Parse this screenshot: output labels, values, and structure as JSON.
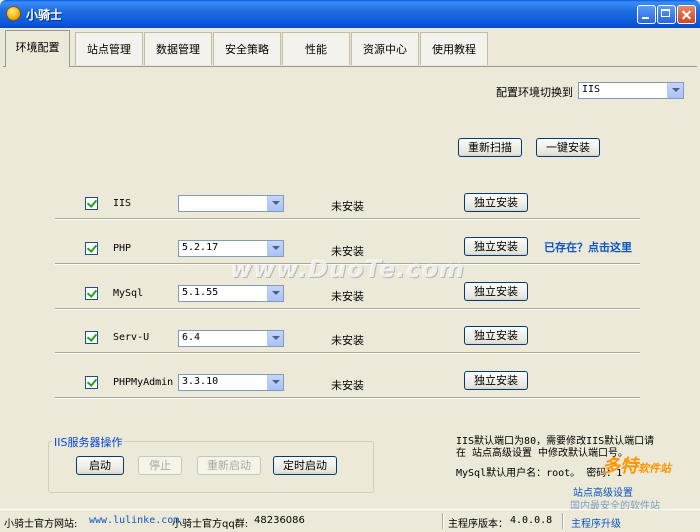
{
  "window": {
    "title": "小骑士"
  },
  "tabs": [
    {
      "label": "环境配置",
      "active": true
    },
    {
      "label": "站点管理"
    },
    {
      "label": "数据管理"
    },
    {
      "label": "安全策略"
    },
    {
      "label": "性能"
    },
    {
      "label": "资源中心"
    },
    {
      "label": "使用教程"
    }
  ],
  "env_switch": {
    "label": "配置环境切换到",
    "value": "IIS"
  },
  "actions": {
    "rescan": "重新扫描",
    "one_click_install": "一键安装"
  },
  "components": [
    {
      "name": "IIS",
      "version": "",
      "status": "未安装",
      "install": "独立安装",
      "checked": true
    },
    {
      "name": "PHP",
      "version": "5.2.17",
      "status": "未安装",
      "install": "独立安装",
      "checked": true,
      "link": "已存在？点击这里"
    },
    {
      "name": "MySql",
      "version": "5.1.55",
      "status": "未安装",
      "install": "独立安装",
      "checked": true
    },
    {
      "name": "Serv-U",
      "version": "6.4",
      "status": "未安装",
      "install": "独立安装",
      "checked": true
    },
    {
      "name": "PHPMyAdmin",
      "version": "3.3.10",
      "status": "未安装",
      "install": "独立安装",
      "checked": true
    }
  ],
  "iis_group": {
    "title": "IIS服务器操作",
    "start": "启动",
    "stop": "停止",
    "restart": "重新启动",
    "scheduled_start": "定时启动"
  },
  "info": {
    "iis_port_line1": "IIS默认端口为80，需要修改IIS默认端口请",
    "iis_port_line2": "在 站点高级设置 中修改默认端口号。",
    "mysql_credentials": "MySql默认用户名：root。 密码：1",
    "site_advanced_settings": "站点高级设置"
  },
  "statusbar": {
    "website_label": "小骑士官方网站:",
    "website_url": "www.lulinke.com",
    "qq_label": "小骑士官方qq群:",
    "qq_value": "48236086",
    "version_label": "主程序版本：",
    "version_value": "4.0.0.8",
    "upgrade": "主程序升级"
  },
  "watermarks": {
    "center": "www.DuoTe.com",
    "logo": "多特",
    "logo_suffix": "软件站",
    "sub": "国内最安全的软件站"
  }
}
